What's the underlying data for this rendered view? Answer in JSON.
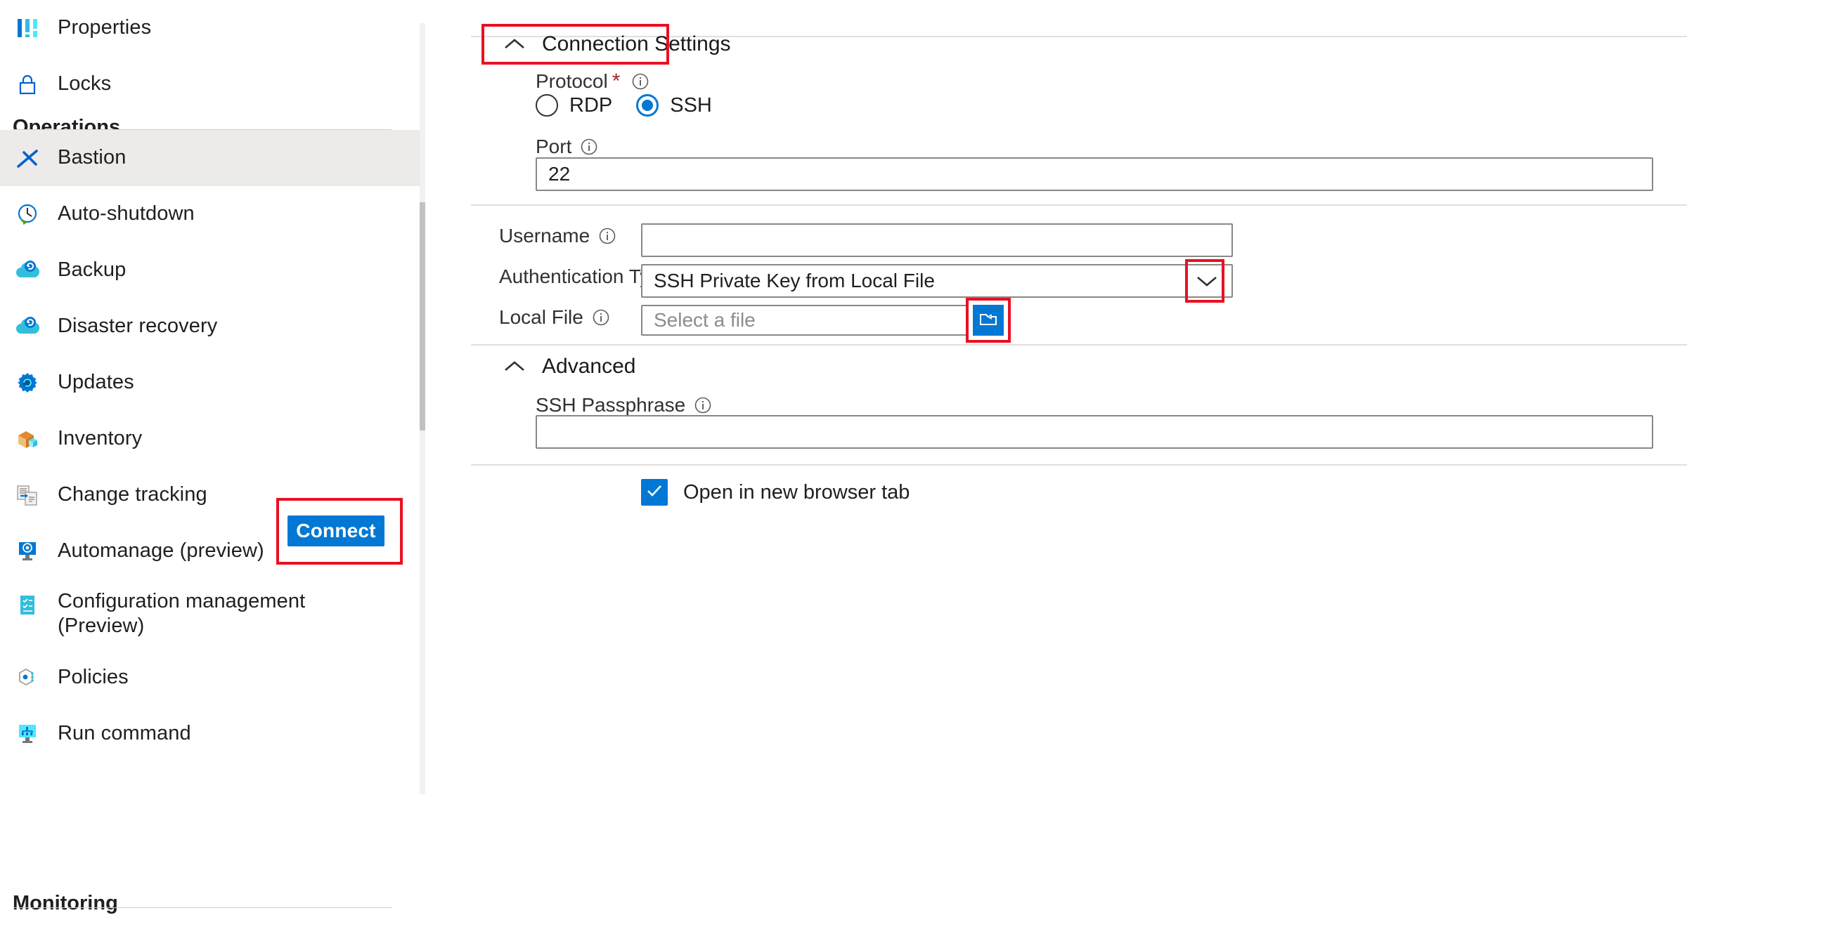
{
  "sidebar": {
    "items_top": [
      {
        "label": "Properties",
        "icon": "properties-icon"
      },
      {
        "label": "Locks",
        "icon": "lock-icon"
      }
    ],
    "section_operations": "Operations",
    "items_operations": [
      {
        "label": "Bastion",
        "icon": "bastion-icon",
        "selected": true
      },
      {
        "label": "Auto-shutdown",
        "icon": "clock-icon",
        "selected": false
      },
      {
        "label": "Backup",
        "icon": "cloud-backup-icon",
        "selected": false
      },
      {
        "label": "Disaster recovery",
        "icon": "cloud-recovery-icon",
        "selected": false
      },
      {
        "label": "Updates",
        "icon": "gear-updates-icon",
        "selected": false
      },
      {
        "label": "Inventory",
        "icon": "box-inventory-icon",
        "selected": false
      },
      {
        "label": "Change tracking",
        "icon": "change-tracking-icon",
        "selected": false
      },
      {
        "label": "Automanage (preview)",
        "icon": "automanage-icon",
        "selected": false
      },
      {
        "label": "Configuration management (Preview)",
        "icon": "config-management-icon",
        "selected": false
      },
      {
        "label": "Policies",
        "icon": "policies-icon",
        "selected": false
      },
      {
        "label": "Run command",
        "icon": "run-command-icon",
        "selected": false
      }
    ],
    "section_monitoring": "Monitoring",
    "scrollbar": {
      "up_arrow": "scroll-up-arrow"
    }
  },
  "main": {
    "connection_settings": {
      "title": "Connection Settings",
      "collapse_icon": "chevron-up-icon",
      "protocol": {
        "label": "Protocol",
        "required_marker": "*",
        "info_icon": "info-icon",
        "options": [
          {
            "label": "RDP",
            "selected": false
          },
          {
            "label": "SSH",
            "selected": true
          }
        ]
      },
      "port": {
        "label": "Port",
        "info_icon": "info-icon",
        "value": "22",
        "placeholder": ""
      }
    },
    "credentials": {
      "username": {
        "label": "Username",
        "info_icon": "info-icon",
        "value": "",
        "placeholder": ""
      },
      "authentication_type": {
        "label": "Authentication Type",
        "info_icon": "info-icon",
        "selected": "SSH Private Key from Local File",
        "chevron_icon": "chevron-down-icon"
      },
      "local_file": {
        "label": "Local File",
        "info_icon": "info-icon",
        "value": "",
        "placeholder": "Select a file",
        "browse_icon": "open-folder-icon"
      }
    },
    "advanced": {
      "title": "Advanced",
      "collapse_icon": "chevron-up-icon",
      "ssh_passphrase": {
        "label": "SSH Passphrase",
        "info_icon": "info-icon",
        "value": "",
        "placeholder": ""
      }
    },
    "footer": {
      "open_new_tab": {
        "label": "Open in new browser tab",
        "checked": true,
        "check_icon": "checkmark-icon"
      },
      "connect_button": "Connect"
    },
    "highlights": {
      "color": "#e81123",
      "regions": [
        "connection-settings-header",
        "authentication-type-dropdown-arrow",
        "local-file-browse-button",
        "connect-button"
      ]
    }
  },
  "colors": {
    "accent": "#0078d4",
    "highlight": "#e81123",
    "selected_row": "#edebe9",
    "border": "#8a8886",
    "divider": "#e1dfdd"
  }
}
